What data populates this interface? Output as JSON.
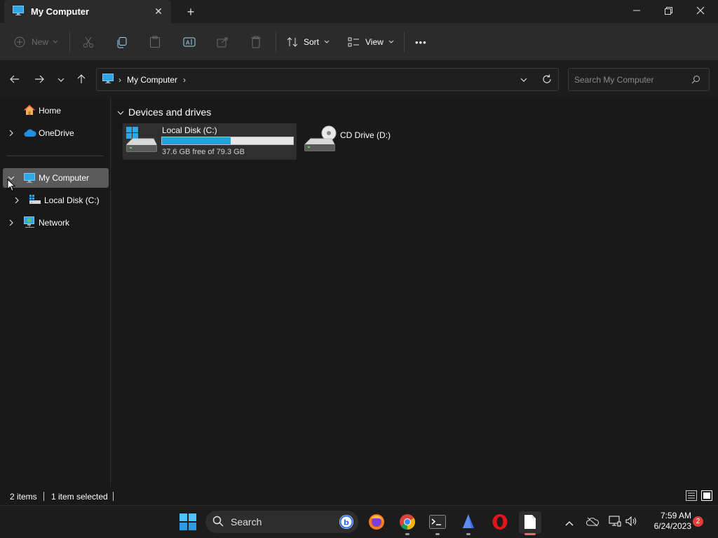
{
  "window": {
    "tab_title": "My Computer",
    "tab_close": "✕",
    "new_tab": "+"
  },
  "toolbar": {
    "new_label": "New",
    "sort_label": "Sort",
    "view_label": "View",
    "more_label": "•••"
  },
  "address": {
    "crumb": "My Computer",
    "chevron": "›"
  },
  "search": {
    "placeholder": "Search My Computer"
  },
  "sidebar": {
    "items": [
      {
        "label": "Home"
      },
      {
        "label": "OneDrive"
      },
      {
        "label": "My Computer"
      },
      {
        "label": "Local Disk (C:)"
      },
      {
        "label": "Network"
      }
    ]
  },
  "content": {
    "group_title": "Devices and drives",
    "drives": [
      {
        "name": "Local Disk (C:)",
        "free_text": "37.6 GB free of 79.3 GB",
        "used_fraction": 0.526
      },
      {
        "name": "CD Drive (D:)"
      }
    ]
  },
  "status": {
    "items_count": "2 items",
    "selection": "1 item selected"
  },
  "taskbar": {
    "search_label": "Search",
    "time": "7:59 AM",
    "date": "6/24/2023",
    "notifications": "2"
  },
  "colors": {
    "accent": "#26a0da",
    "selection": "#5a5a5a"
  }
}
